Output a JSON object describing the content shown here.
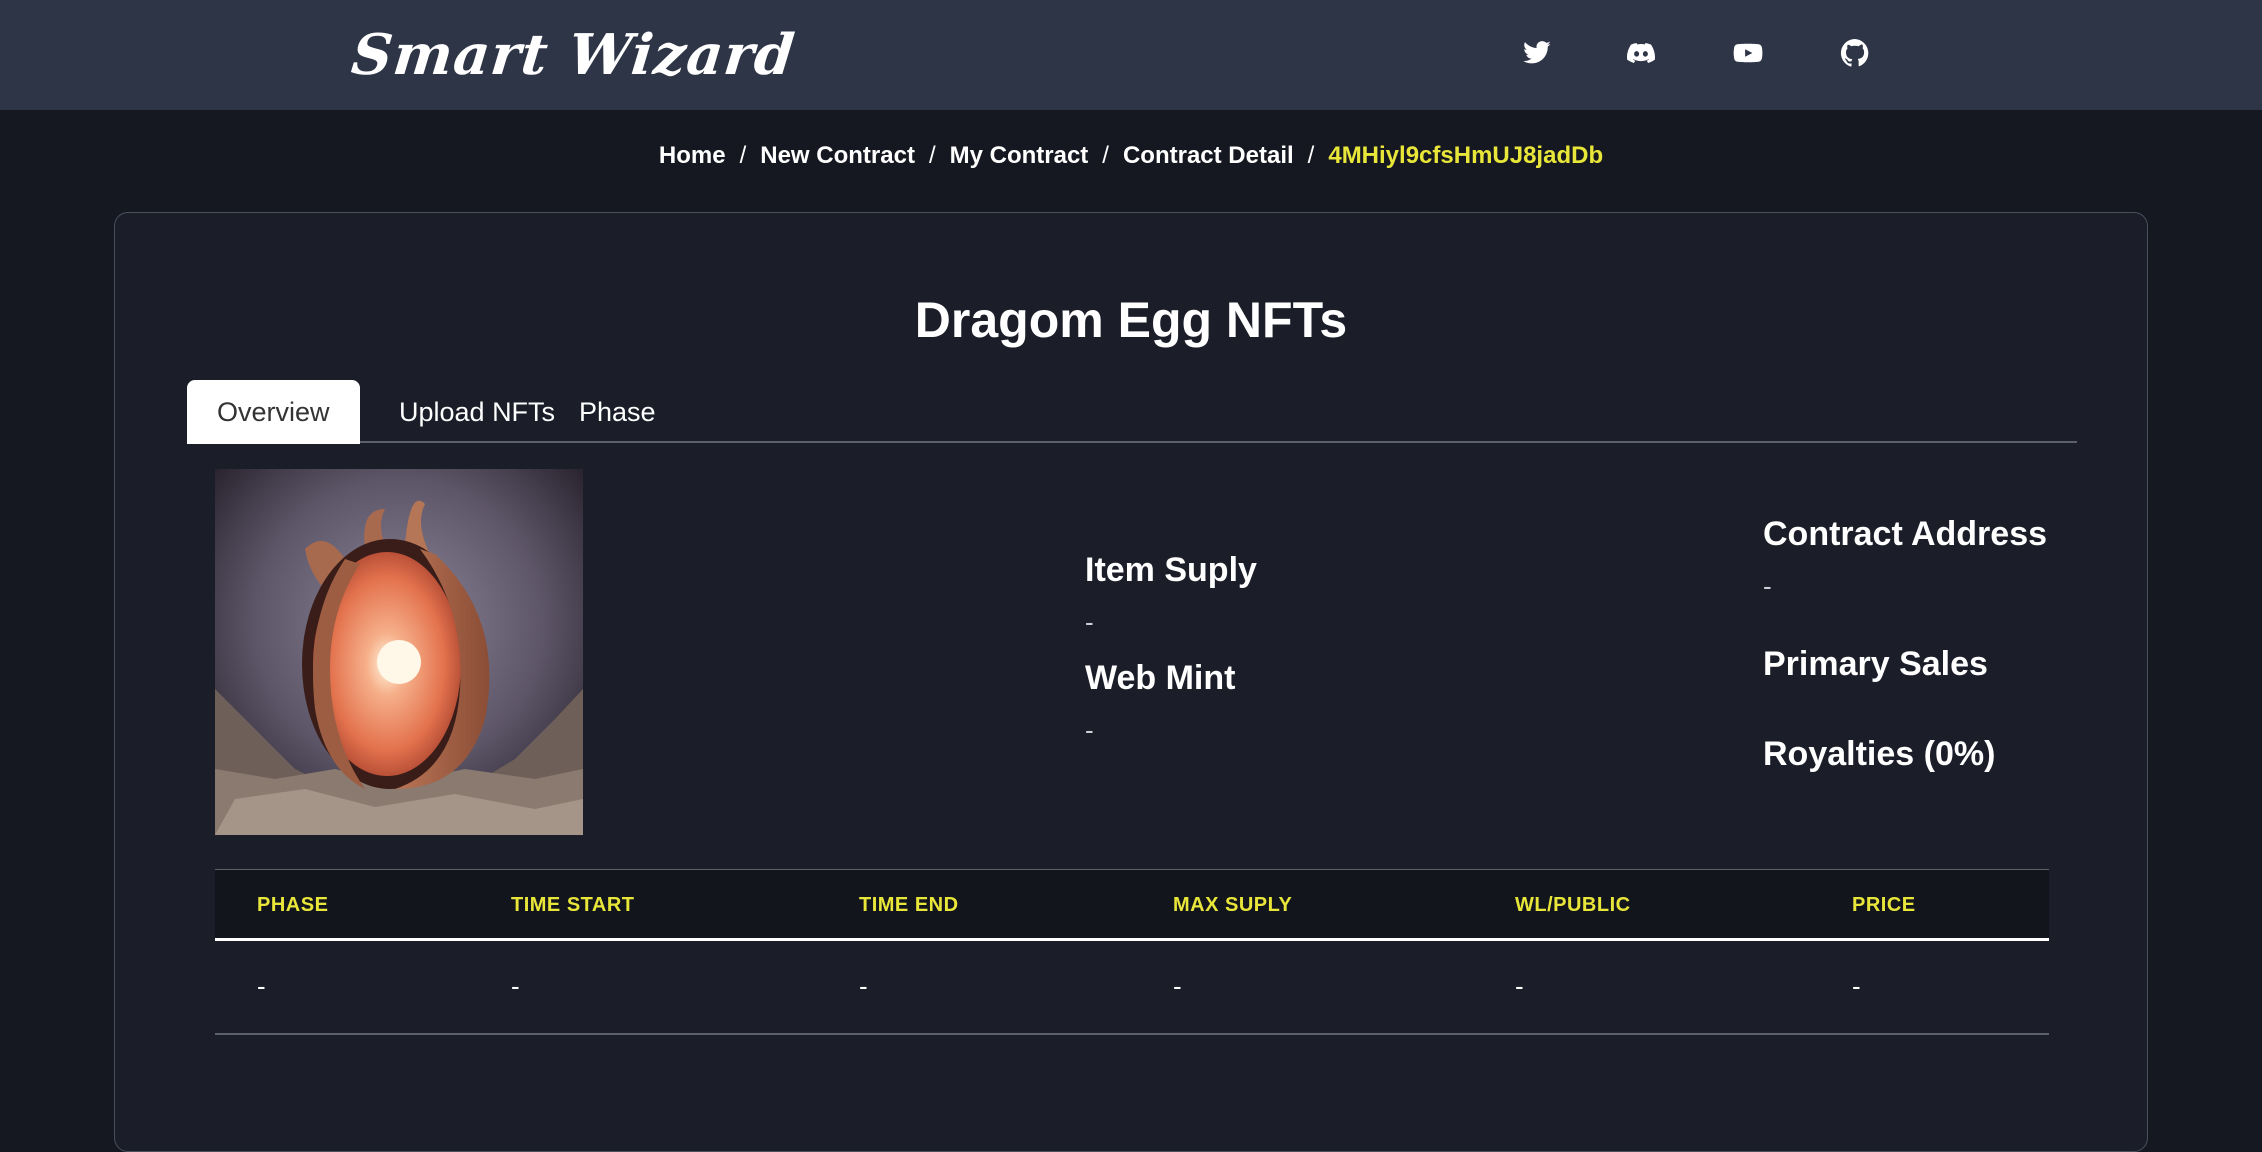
{
  "header": {
    "logo": "Smart Wizard",
    "social": [
      "twitter-icon",
      "discord-icon",
      "youtube-icon",
      "github-icon"
    ]
  },
  "breadcrumb": {
    "items": [
      "Home",
      "New Contract",
      "My Contract",
      "Contract Detail"
    ],
    "current": "4MHiyl9cfsHmUJ8jadDb",
    "separator": "/"
  },
  "page": {
    "title": "Dragom Egg NFTs",
    "tabs": [
      "Overview",
      "Upload NFTs",
      "Phase"
    ]
  },
  "details": {
    "item_supply_label": "Item Suply",
    "item_supply_value": "-",
    "web_mint_label": "Web Mint",
    "web_mint_value": "-",
    "contract_address_label": "Contract Address",
    "contract_address_value": "-",
    "primary_sales_label": "Primary Sales",
    "royalties_label": "Royalties (0%)"
  },
  "table": {
    "headers": [
      "PHASE",
      "TIME START",
      "TIME END",
      "MAX SUPLY",
      "WL/PUBLIC",
      "PRICE"
    ],
    "rows": [
      [
        "-",
        "-",
        "-",
        "-",
        "-",
        "-"
      ]
    ]
  },
  "colors": {
    "accent": "#e9e63a",
    "header_bg": "#2e3546",
    "page_bg": "#161821",
    "card_bg": "#1b1e29"
  }
}
